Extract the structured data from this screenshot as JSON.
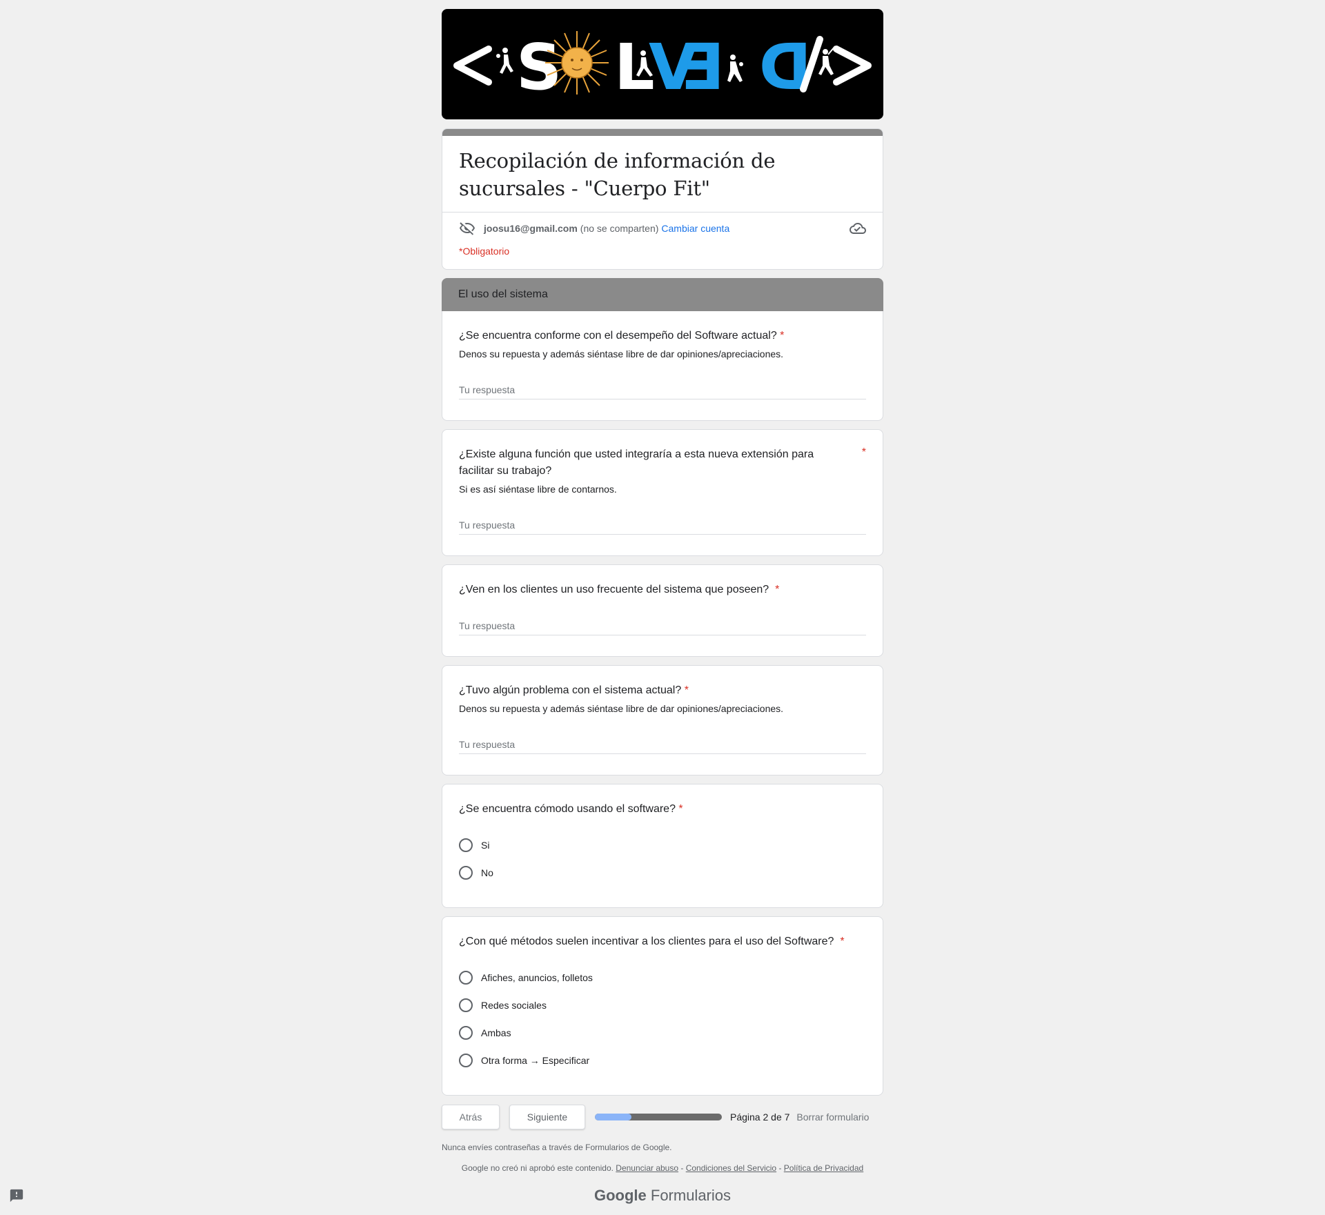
{
  "banner": {
    "logo_text_left": "<S",
    "logo_text_mid": "LV",
    "logo_text_right": "3D",
    "logo_text_end": "/>",
    "colors": {
      "background": "#000000",
      "white": "#ffffff",
      "blue": "#1e9be9",
      "sun": "#e8a33a"
    }
  },
  "form": {
    "title": "Recopilación de información de sucursales - \"Cuerpo Fit\"",
    "account_email": "joosu16@gmail.com",
    "account_not_shared": "(no se comparten)",
    "switch_account": "Cambiar cuenta",
    "required_note": "*Obligatorio",
    "icons": {
      "privacy": "eye-off-icon",
      "save": "cloud-done-icon"
    }
  },
  "section": {
    "title": "El uso del sistema"
  },
  "questions": [
    {
      "title": "¿Se encuentra conforme con el desempeño del Software actual?",
      "required": "*",
      "description": "Denos su repuesta y además siéntase libre de dar opiniones/apreciaciones.",
      "placeholder": "Tu respuesta"
    },
    {
      "title": "¿Existe alguna función que usted integraría a esta nueva extensión para facilitar su trabajo?",
      "required": "*",
      "description": "Si es así siéntase libre de contarnos.",
      "placeholder": "Tu respuesta"
    },
    {
      "title": "¿Ven en los clientes un uso frecuente del sistema que poseen?",
      "required": "*",
      "placeholder": "Tu respuesta"
    },
    {
      "title": "¿Tuvo algún problema con el sistema actual?",
      "required": "*",
      "description": "Denos su repuesta y además siéntase libre de dar opiniones/apreciaciones.",
      "placeholder": "Tu respuesta"
    },
    {
      "title": "¿Se encuentra cómodo usando el software?",
      "required": "*",
      "options": [
        "Si",
        "No"
      ]
    },
    {
      "title": "¿Con qué métodos suelen incentivar a los clientes para el uso del Software?",
      "required": "*",
      "options": [
        "Afiches, anuncios, folletos",
        "Redes sociales",
        "Ambas",
        "Otra forma → Especificar"
      ]
    }
  ],
  "nav": {
    "back": "Atrás",
    "next": "Siguiente",
    "progress_fraction": 0.2857,
    "page_info": "Página 2 de 7",
    "clear": "Borrar formulario",
    "progress_colors": {
      "fill": "#8ab4f8",
      "track": "#6b6b6b"
    }
  },
  "footer": {
    "password_warning": "Nunca envíes contraseñas a través de Formularios de Google.",
    "disclaimer": "Google no creó ni aprobó este contenido.",
    "report_abuse": "Denunciar abuso",
    "terms": "Condiciones del Servicio",
    "privacy": "Política de Privacidad",
    "separator": " - ",
    "brand_google": "Google",
    "brand_forms": "Formularios",
    "feedback_icon": "report-feedback-icon"
  }
}
